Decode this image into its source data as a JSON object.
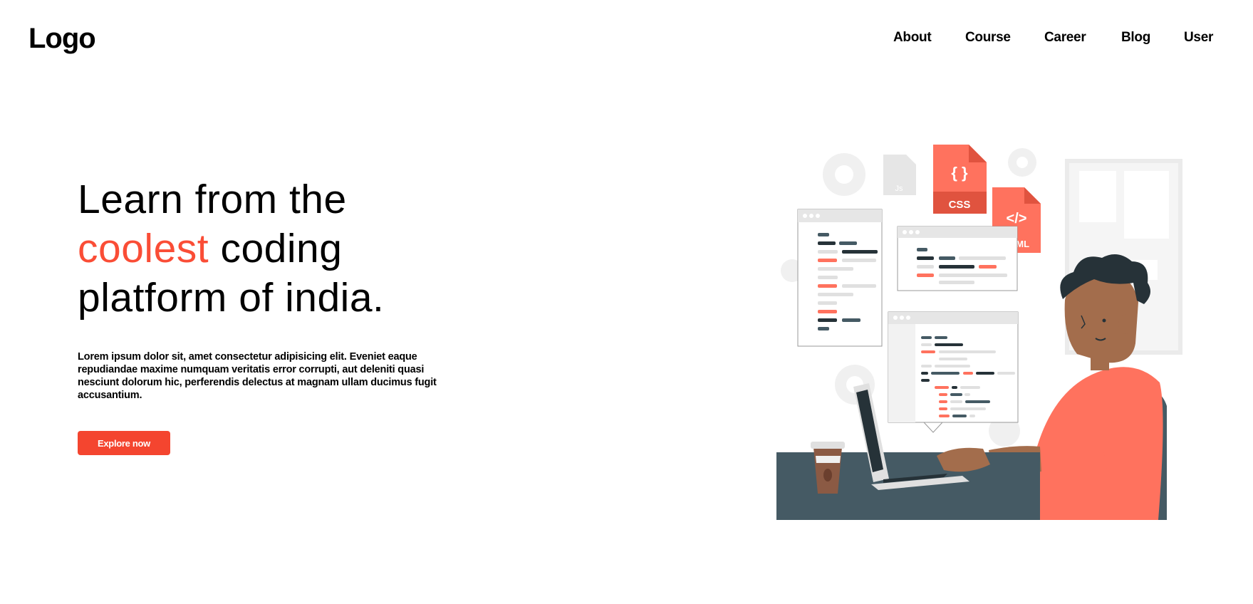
{
  "header": {
    "logo": "Logo",
    "nav": [
      "About",
      "Course",
      "Career",
      "Blog",
      "User"
    ]
  },
  "hero": {
    "title_line1": "Learn from the",
    "title_accent": "coolest",
    "title_line2_rest": " coding",
    "title_line3": "platform of india.",
    "description": "Lorem ipsum dolor sit, amet consectetur adipisicing elit. Eveniet eaque repudiandae maxime numquam veritatis error corrupti, aut deleniti quasi nesciunt dolorum hic, perferendis delectus at magnam ullam ducimus fugit accusantium.",
    "cta_label": "Explore now"
  },
  "illustration": {
    "css_badge": "CSS",
    "html_badge": "HTML",
    "js_badge": "Js",
    "braces": "{ }",
    "tag": "</>"
  },
  "colors": {
    "accent": "#fa4d36",
    "button": "#f4452f",
    "illustration_primary": "#ff725e",
    "desk": "#455a64"
  }
}
